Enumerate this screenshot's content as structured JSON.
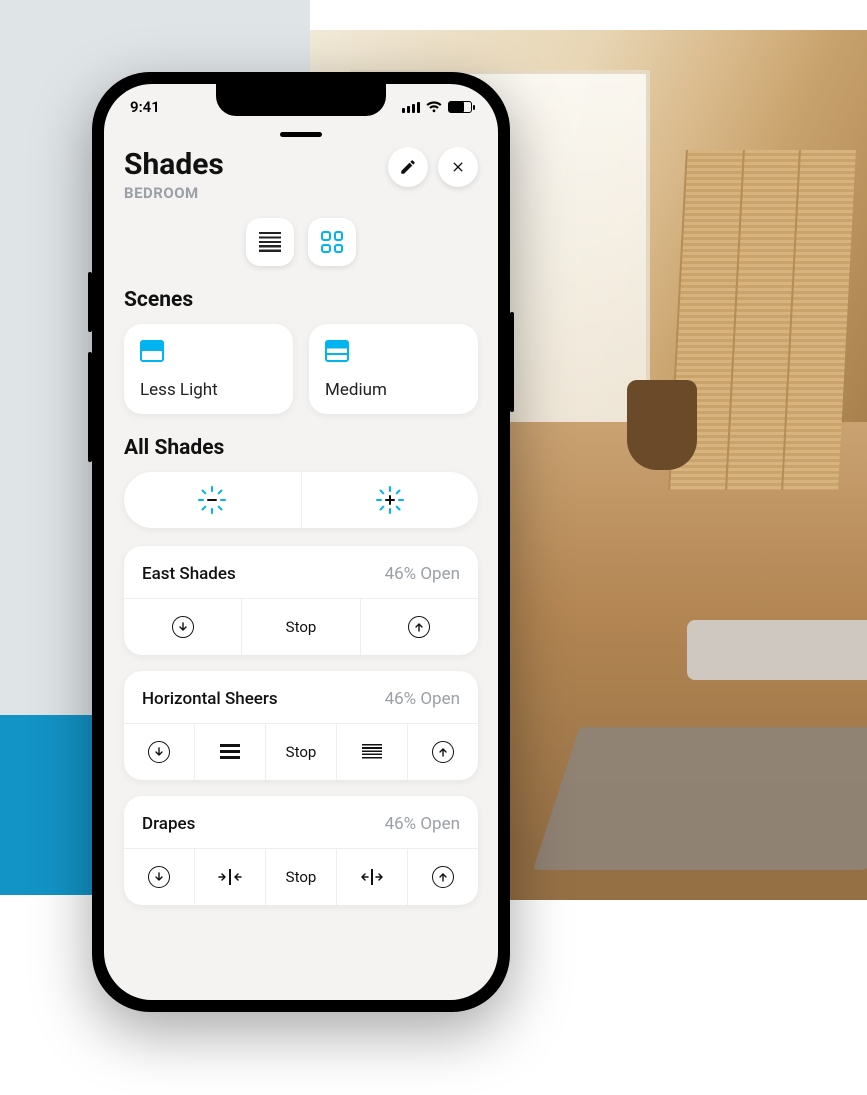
{
  "status": {
    "time": "9:41"
  },
  "header": {
    "title": "Shades",
    "subtitle": "BEDROOM"
  },
  "sections": {
    "scenes": "Scenes",
    "all_shades": "All Shades"
  },
  "scenes": [
    {
      "label": "Less Light"
    },
    {
      "label": "Medium"
    }
  ],
  "stop_label": "Stop",
  "shades": [
    {
      "name": "East Shades",
      "status": "46% Open"
    },
    {
      "name": "Horizontal Sheers",
      "status": "46% Open"
    },
    {
      "name": "Drapes",
      "status": "46% Open"
    }
  ],
  "colors": {
    "accent": "#00b4f0"
  }
}
